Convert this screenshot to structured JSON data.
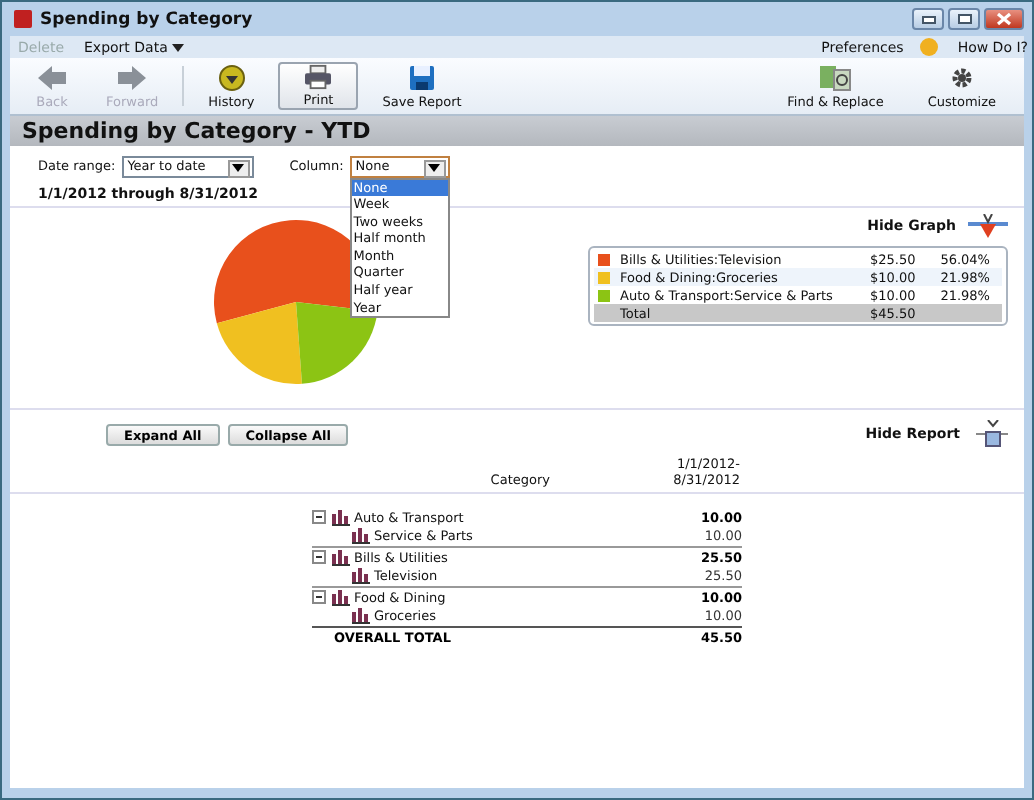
{
  "window": {
    "title": "Spending by Category"
  },
  "menu": [
    {
      "label": "Delete",
      "disabled": true,
      "has_menu": false
    },
    {
      "label": "Export Data",
      "disabled": false,
      "has_menu": true
    }
  ],
  "help_links": [
    {
      "label": "Preferences"
    },
    {
      "label": "How Do I?"
    }
  ],
  "toolbar_left": [
    {
      "label": "Back",
      "disabled": true,
      "selected": false
    },
    {
      "label": "Forward",
      "disabled": true,
      "selected": false
    },
    {
      "label": "History",
      "disabled": false,
      "selected": false
    },
    {
      "label": "Print",
      "disabled": false,
      "selected": true
    },
    {
      "label": "Save Report",
      "disabled": false,
      "selected": false
    }
  ],
  "toolbar_right": [
    {
      "label": "Find & Replace"
    },
    {
      "label": "Customize"
    }
  ],
  "report_title": "Spending by Category - YTD",
  "date_range": {
    "label": "Date range:",
    "value": "Year to date"
  },
  "column": {
    "label": "Column:",
    "value": "None",
    "expanded": true,
    "options": [
      {
        "label": "None",
        "selected": true
      },
      {
        "label": "Week",
        "selected": false
      },
      {
        "label": "Two weeks",
        "selected": false
      },
      {
        "label": "Half month",
        "selected": false
      },
      {
        "label": "Month",
        "selected": false
      },
      {
        "label": "Quarter",
        "selected": false
      },
      {
        "label": "Half year",
        "selected": false
      },
      {
        "label": "Year",
        "selected": false
      }
    ]
  },
  "period": "1/1/2012 through 8/31/2012",
  "graph": {
    "toggle": "Hide Graph",
    "chart_data": {
      "type": "pie",
      "series": [
        {
          "values": [
            56.04,
            21.98,
            21.98
          ]
        }
      ]
    },
    "legend": [
      {
        "label": "Bills & Utilities:Television",
        "amount": "$25.50",
        "percent": "56.04%",
        "color": "#e8501c"
      },
      {
        "label": "Food & Dining:Groceries",
        "amount": "$10.00",
        "percent": "21.98%",
        "color": "#f0c020"
      },
      {
        "label": "Auto & Transport:Service & Parts",
        "amount": "$10.00",
        "percent": "21.98%",
        "color": "#8cc414"
      }
    ],
    "total": {
      "label": "Total",
      "amount": "$45.50"
    }
  },
  "report": {
    "buttons": [
      "Expand All",
      "Collapse All"
    ],
    "toggle": "Hide Report",
    "category_header": "Category",
    "date_header": [
      "1/1/2012-",
      "8/31/2012"
    ],
    "rows": [
      {
        "label": "Auto & Transport",
        "amount": "10.00",
        "expanded": true,
        "children": [
          {
            "label": "Service & Parts",
            "amount": "10.00"
          }
        ]
      },
      {
        "label": "Bills & Utilities",
        "amount": "25.50",
        "expanded": true,
        "children": [
          {
            "label": "Television",
            "amount": "25.50"
          }
        ]
      },
      {
        "label": "Food & Dining",
        "amount": "10.00",
        "expanded": true,
        "children": [
          {
            "label": "Groceries",
            "amount": "10.00"
          }
        ]
      }
    ],
    "total": {
      "label": "OVERALL TOTAL",
      "amount": "45.50"
    }
  }
}
